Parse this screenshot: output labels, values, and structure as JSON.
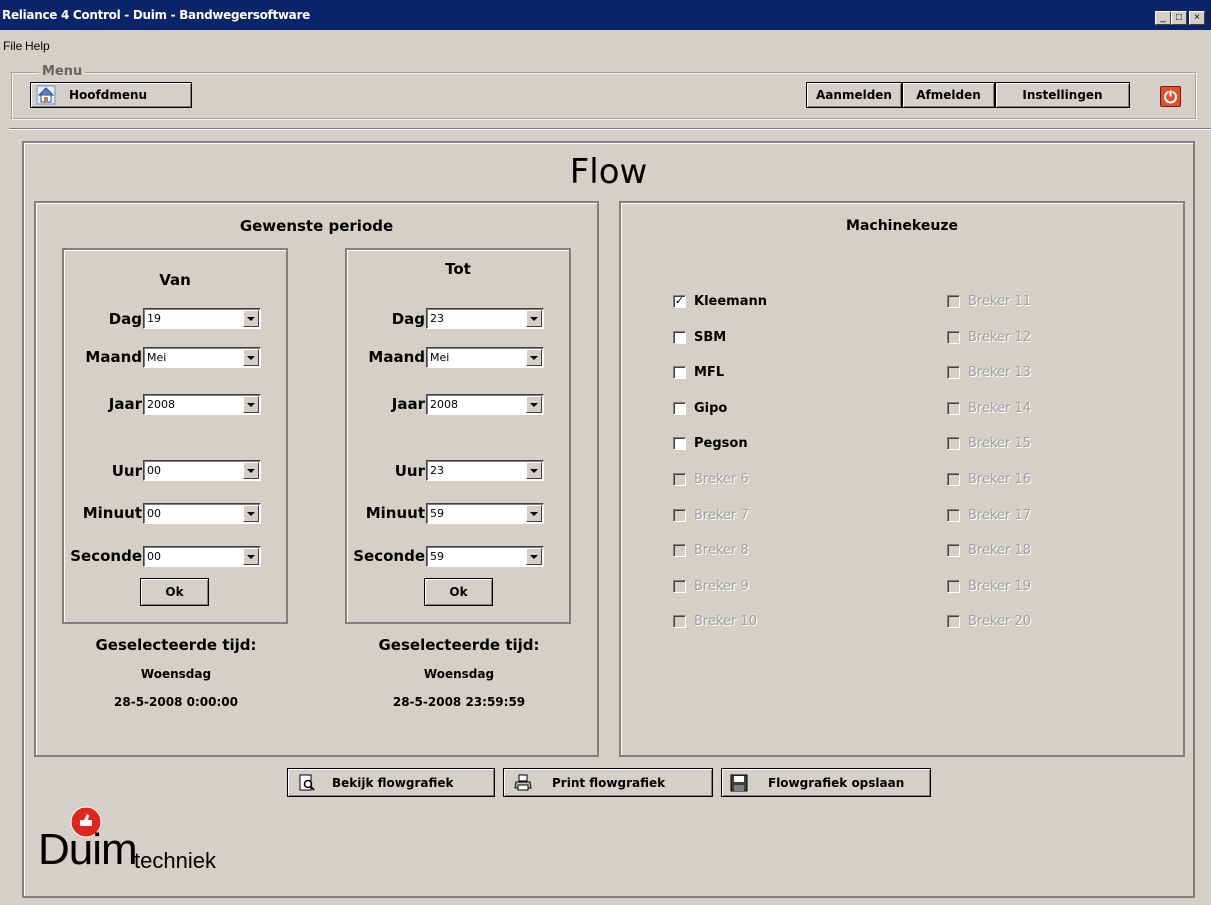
{
  "window": {
    "title": "Reliance 4 Control - Duim - Bandwegersoftware",
    "controls": {
      "minimize": "_",
      "maximize": "□",
      "close": "×"
    }
  },
  "menubar": {
    "file": "File",
    "help": "Help"
  },
  "menu_group": {
    "legend": "Menu",
    "hoofdmenu": "Hoofdmenu",
    "aanmelden": "Aanmelden",
    "afmelden": "Afmelden",
    "instellingen": "Instellingen"
  },
  "page": {
    "title": "Flow"
  },
  "periode": {
    "title": "Gewenste periode",
    "van": {
      "title": "Van",
      "labels": {
        "dag": "Dag",
        "maand": "Maand",
        "jaar": "Jaar",
        "uur": "Uur",
        "minuut": "Minuut",
        "seconde": "Seconde"
      },
      "values": {
        "dag": "19",
        "maand": "Mei",
        "jaar": "2008",
        "uur": "00",
        "minuut": "00",
        "seconde": "00"
      },
      "ok": "Ok",
      "selected_label": "Geselecteerde tijd:",
      "selected_day": "Woensdag",
      "selected_datetime": "28-5-2008 0:00:00"
    },
    "tot": {
      "title": "Tot",
      "labels": {
        "dag": "Dag",
        "maand": "Maand",
        "jaar": "Jaar",
        "uur": "Uur",
        "minuut": "Minuut",
        "seconde": "Seconde"
      },
      "values": {
        "dag": "23",
        "maand": "Mei",
        "jaar": "2008",
        "uur": "23",
        "minuut": "59",
        "seconde": "59"
      },
      "ok": "Ok",
      "selected_label": "Geselecteerde tijd:",
      "selected_day": "Woensdag",
      "selected_datetime": "28-5-2008 23:59:59"
    }
  },
  "machinekeuze": {
    "title": "Machinekeuze",
    "left": [
      {
        "label": "Kleemann",
        "checked": true,
        "enabled": true
      },
      {
        "label": "SBM",
        "checked": false,
        "enabled": true
      },
      {
        "label": "MFL",
        "checked": false,
        "enabled": true
      },
      {
        "label": "Gipo",
        "checked": false,
        "enabled": true
      },
      {
        "label": "Pegson",
        "checked": false,
        "enabled": true
      },
      {
        "label": "Breker 6",
        "checked": false,
        "enabled": false
      },
      {
        "label": "Breker 7",
        "checked": false,
        "enabled": false
      },
      {
        "label": "Breker 8",
        "checked": false,
        "enabled": false
      },
      {
        "label": "Breker 9",
        "checked": false,
        "enabled": false
      },
      {
        "label": "Breker 10",
        "checked": false,
        "enabled": false
      }
    ],
    "right": [
      {
        "label": "Breker 11",
        "checked": false,
        "enabled": false
      },
      {
        "label": "Breker 12",
        "checked": false,
        "enabled": false
      },
      {
        "label": "Breker 13",
        "checked": false,
        "enabled": false
      },
      {
        "label": "Breker 14",
        "checked": false,
        "enabled": false
      },
      {
        "label": "Breker 15",
        "checked": false,
        "enabled": false
      },
      {
        "label": "Breker 16",
        "checked": false,
        "enabled": false
      },
      {
        "label": "Breker 17",
        "checked": false,
        "enabled": false
      },
      {
        "label": "Breker 18",
        "checked": false,
        "enabled": false
      },
      {
        "label": "Breker 19",
        "checked": false,
        "enabled": false
      },
      {
        "label": "Breker 20",
        "checked": false,
        "enabled": false
      }
    ]
  },
  "actions": {
    "bekijk": "Bekijk flowgrafiek",
    "print": "Print flowgrafiek",
    "opslaan": "Flowgrafiek opslaan"
  },
  "logo": {
    "brand": "Duim",
    "suffix": "techniek"
  },
  "icons": {
    "home": "home-icon",
    "power": "power-icon",
    "preview": "magnifier-page-icon",
    "print": "printer-icon",
    "save": "floppy-disk-icon",
    "logo": "thumbs-up-icon"
  },
  "colors": {
    "titlebar": "#0a246a",
    "power_button": "#e0502e",
    "logo_red": "#e0261c"
  }
}
